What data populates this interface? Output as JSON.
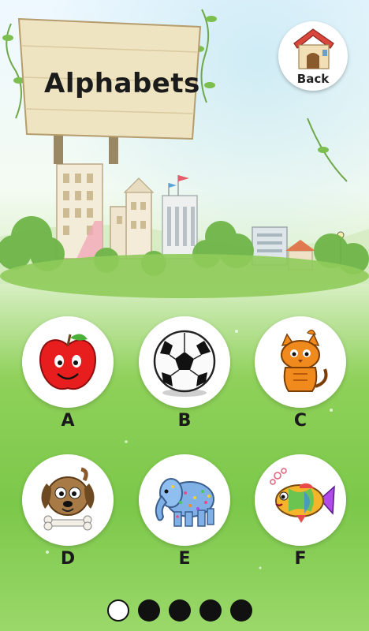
{
  "header": {
    "title": "Alphabets",
    "back_label": "Back"
  },
  "tiles": [
    {
      "letter": "A",
      "icon": "apple-icon"
    },
    {
      "letter": "B",
      "icon": "soccer-ball-icon"
    },
    {
      "letter": "C",
      "icon": "cat-icon"
    },
    {
      "letter": "D",
      "icon": "dog-icon"
    },
    {
      "letter": "E",
      "icon": "elephant-icon"
    },
    {
      "letter": "F",
      "icon": "fish-icon"
    }
  ],
  "pager": {
    "pages": 5,
    "active_page": 1
  }
}
